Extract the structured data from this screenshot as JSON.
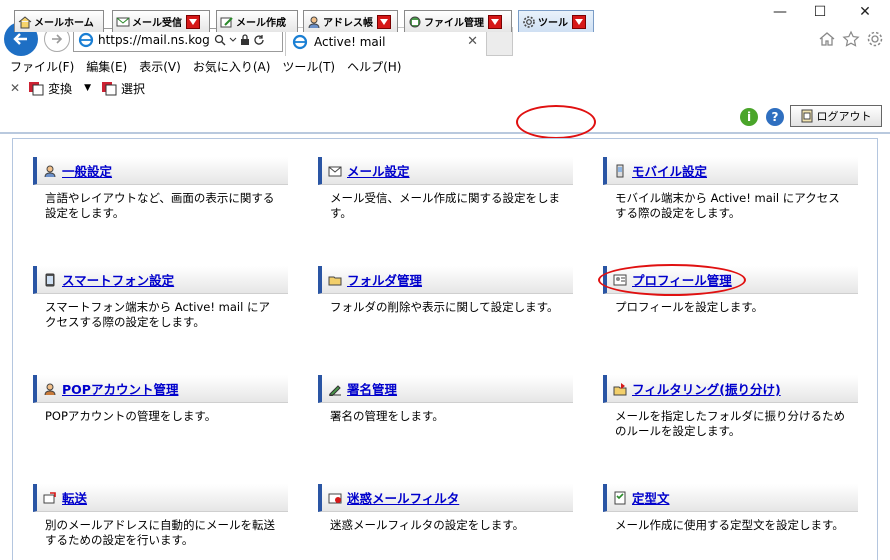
{
  "browser": {
    "url": "https://mail.ns.kog...",
    "tab_title": "Active! mail",
    "window_controls": [
      "—",
      "☐",
      "✕"
    ]
  },
  "menubar": {
    "items": [
      "ファイル(F)",
      "編集(E)",
      "表示(V)",
      "お気に入り(A)",
      "ツール(T)",
      "ヘルプ(H)"
    ]
  },
  "favbar": {
    "convert_label": "変換",
    "select_label": "選択"
  },
  "apptoolbar": {
    "tabs": [
      {
        "label": "メールホーム",
        "icon": "home-icon"
      },
      {
        "label": "メール受信",
        "icon": "inbox-icon"
      },
      {
        "label": "メール作成",
        "icon": "compose-icon"
      },
      {
        "label": "アドレス帳",
        "icon": "addressbook-icon"
      },
      {
        "label": "ファイル管理",
        "icon": "file-icon"
      },
      {
        "label": "ツール",
        "icon": "gear-icon"
      }
    ],
    "logout_label": "ログアウト"
  },
  "cards": [
    {
      "title": "一般設定",
      "icon": "user-icon",
      "desc": "言語やレイアウトなど、画面の表示に関する設定をします。"
    },
    {
      "title": "メール設定",
      "icon": "mail-icon",
      "desc": "メール受信、メール作成に関する設定をします。"
    },
    {
      "title": "モバイル設定",
      "icon": "mobile-icon",
      "desc": "モバイル端末から Active! mail にアクセスする際の設定をします。"
    },
    {
      "title": "スマートフォン設定",
      "icon": "smartphone-icon",
      "desc": "スマートフォン端末から Active! mail にアクセスする際の設定をします。"
    },
    {
      "title": "フォルダ管理",
      "icon": "folder-icon",
      "desc": "フォルダの削除や表示に関して設定します。"
    },
    {
      "title": "プロフィール管理",
      "icon": "profile-icon",
      "desc": "プロフィールを設定します。"
    },
    {
      "title": "POPアカウント管理",
      "icon": "user-icon",
      "desc": "POPアカウントの管理をします。"
    },
    {
      "title": "署名管理",
      "icon": "pen-icon",
      "desc": "署名の管理をします。"
    },
    {
      "title": "フィルタリング(振り分け)",
      "icon": "filter-icon",
      "desc": "メールを指定したフォルダに振り分けるためのルールを設定します。"
    },
    {
      "title": "転送",
      "icon": "forward-icon",
      "desc": "別のメールアドレスに自動的にメールを転送するための設定を行います。"
    },
    {
      "title": "迷惑メールフィルタ",
      "icon": "spam-icon",
      "desc": "迷惑メールフィルタの設定をします。"
    },
    {
      "title": "定型文",
      "icon": "template-icon",
      "desc": "メール作成に使用する定型文を設定します。"
    }
  ],
  "colors": {
    "accent": "#2a55a4",
    "link": "#0000cc",
    "dropdown": "#d61818",
    "highlight": "#e01010"
  }
}
